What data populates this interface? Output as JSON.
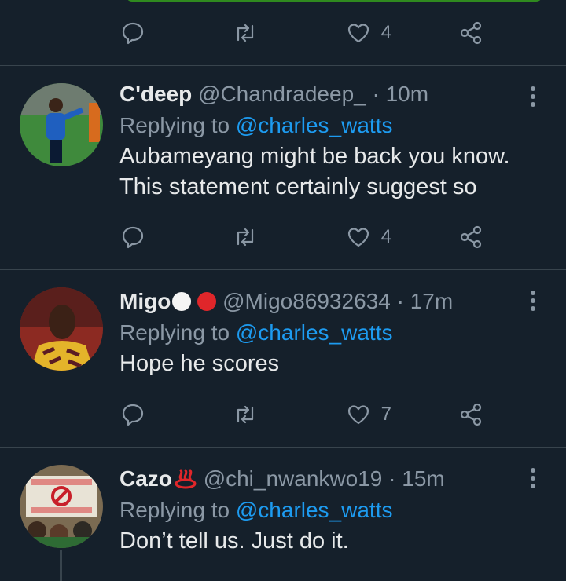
{
  "top_actions": {
    "like_count": "4"
  },
  "tweets": [
    {
      "name": "C'deep",
      "handle": "@Chandradeep_",
      "separator": "·",
      "time": "10m",
      "replying_prefix": "Replying to ",
      "replying_to": "@charles_watts",
      "text": "Aubameyang might be back you know. This statement certainly suggest so",
      "like_count": "4"
    },
    {
      "name": "Migo",
      "name_emoji": [
        "white circle",
        "red circle"
      ],
      "handle": "@Migo86932634",
      "separator": "·",
      "time": "17m",
      "replying_prefix": "Replying to ",
      "replying_to": "@charles_watts",
      "text": "Hope he scores",
      "like_count": "7"
    },
    {
      "name": "Cazo",
      "name_emoji": [
        "hot springs"
      ],
      "handle": "@chi_nwankwo19",
      "separator": "·",
      "time": "15m",
      "replying_prefix": "Replying to ",
      "replying_to": "@charles_watts",
      "text": "Don’t tell us. Just do it."
    }
  ],
  "colors": {
    "background": "#15202b",
    "text": "#e7e9ea",
    "muted": "#8b98a5",
    "link": "#1d9bf0",
    "divider": "#38444d"
  }
}
